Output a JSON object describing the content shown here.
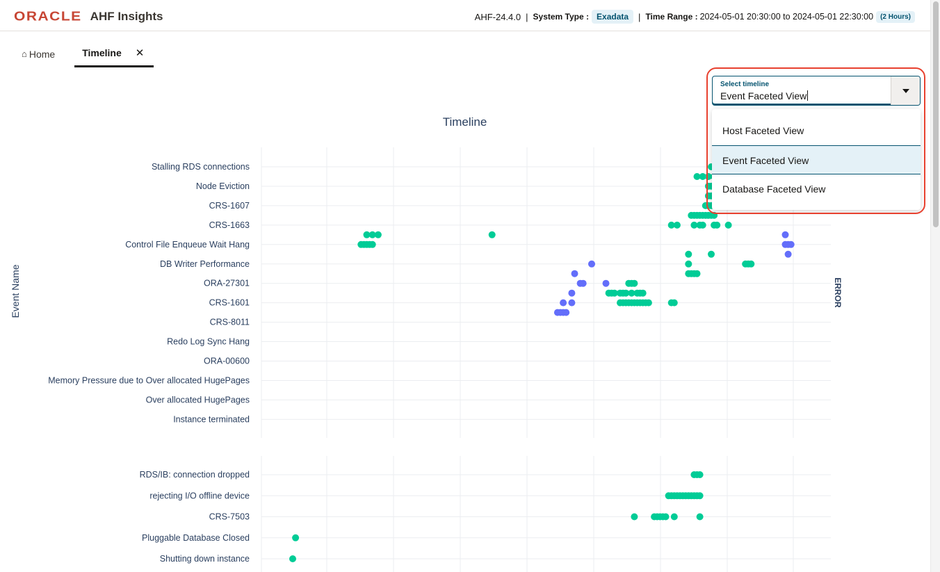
{
  "header": {
    "logo_text": "ORACLE",
    "app_name": "AHF Insights",
    "version": "AHF-24.4.0",
    "system_type_label": "System Type :",
    "system_type_value": "Exadata",
    "time_range_label": "Time Range :",
    "time_range_value": "2024-05-01 20:30:00 to 2024-05-01 22:30:00",
    "time_range_duration": "(2 Hours)"
  },
  "tabs": [
    {
      "label": "Home",
      "icon": "home-icon"
    },
    {
      "label": "Timeline",
      "close_icon": "close-icon"
    }
  ],
  "select": {
    "caption": "Select timeline",
    "value": "Event Faceted View",
    "options": [
      "Host Faceted View",
      "Event Faceted View",
      "Database Faceted View"
    ],
    "selected_index": 1
  },
  "colors": {
    "accent": "#04536f",
    "oracle_red": "#c74634",
    "highlight_red": "#e8412f",
    "marker_green": "#00cc96",
    "marker_purple": "#636efa"
  },
  "chart_data": {
    "type": "scatter",
    "title": "Timeline",
    "ylabel": "Event Name",
    "facets": [
      {
        "name": "ERROR",
        "categories": [
          "Stalling RDS connections",
          "Node Eviction",
          "CRS-1607",
          "CRS-1663",
          "Control File Enqueue Wait Hang",
          "DB Writer Performance",
          "ORA-27301",
          "CRS-1601",
          "CRS-8011",
          "Redo Log Sync Hang",
          "ORA-00600",
          "Memory Pressure due to Over allocated HugePages",
          "Over allocated HugePages",
          "Instance terminated"
        ],
        "series": [
          {
            "color": "#00cc96",
            "points": [
              [
                0,
                0.79
              ],
              [
                0,
                0.8
              ],
              [
                0,
                0.81
              ],
              [
                0,
                0.83
              ],
              [
                1,
                0.765
              ],
              [
                1,
                0.775
              ],
              [
                1,
                0.785
              ],
              [
                1,
                0.795
              ],
              [
                1,
                0.805
              ],
              [
                2,
                0.785
              ],
              [
                2,
                0.79
              ],
              [
                2,
                0.795
              ],
              [
                3,
                0.785
              ],
              [
                3,
                0.79
              ],
              [
                3,
                0.795
              ],
              [
                4,
                0.78
              ],
              [
                4,
                0.785
              ],
              [
                4,
                0.79
              ],
              [
                4,
                0.795
              ],
              [
                5,
                0.755
              ],
              [
                5,
                0.76
              ],
              [
                5,
                0.765
              ],
              [
                5,
                0.77
              ],
              [
                5,
                0.775
              ],
              [
                5,
                0.78
              ],
              [
                5,
                0.785
              ],
              [
                5,
                0.79
              ],
              [
                5,
                0.795
              ],
              [
                6,
                0.72
              ],
              [
                6,
                0.73
              ],
              [
                6,
                0.76
              ],
              [
                6,
                0.77
              ],
              [
                6,
                0.775
              ],
              [
                6,
                0.795
              ],
              [
                6,
                0.8
              ],
              [
                6,
                0.82
              ],
              [
                7,
                0.185
              ],
              [
                7,
                0.195
              ],
              [
                7,
                0.205
              ],
              [
                7,
                0.405
              ],
              [
                8,
                0.175
              ],
              [
                8,
                0.18
              ],
              [
                8,
                0.185
              ],
              [
                8,
                0.19
              ],
              [
                8,
                0.195
              ],
              [
                9,
                0.75
              ],
              [
                9,
                0.79
              ],
              [
                10,
                0.75
              ],
              [
                10,
                0.85
              ],
              [
                10,
                0.855
              ],
              [
                10,
                0.86
              ],
              [
                11,
                0.75
              ],
              [
                11,
                0.755
              ],
              [
                11,
                0.76
              ],
              [
                11,
                0.765
              ],
              [
                12,
                0.645
              ],
              [
                12,
                0.65
              ],
              [
                12,
                0.655
              ],
              [
                13,
                0.61
              ],
              [
                13,
                0.615
              ],
              [
                13,
                0.62
              ],
              [
                13,
                0.63
              ],
              [
                13,
                0.635
              ],
              [
                13,
                0.64
              ],
              [
                13,
                0.65
              ],
              [
                13,
                0.66
              ],
              [
                13,
                0.665
              ],
              [
                13,
                0.67
              ],
              [
                14,
                0.63
              ],
              [
                14,
                0.635
              ],
              [
                14,
                0.64
              ],
              [
                14,
                0.645
              ],
              [
                14,
                0.65
              ],
              [
                14,
                0.655
              ],
              [
                14,
                0.66
              ],
              [
                14,
                0.665
              ],
              [
                14,
                0.67
              ],
              [
                14,
                0.675
              ],
              [
                14,
                0.68
              ],
              [
                14,
                0.72
              ],
              [
                14,
                0.725
              ]
            ]
          },
          {
            "color": "#636efa",
            "points": [
              [
                7,
                0.92
              ],
              [
                8,
                0.92
              ],
              [
                8,
                0.925
              ],
              [
                8,
                0.93
              ],
              [
                9,
                0.925
              ],
              [
                10,
                0.58
              ],
              [
                11,
                0.55
              ],
              [
                12,
                0.56
              ],
              [
                12,
                0.565
              ],
              [
                12,
                0.605
              ],
              [
                13,
                0.545
              ],
              [
                14,
                0.53
              ],
              [
                14,
                0.545
              ],
              [
                15,
                0.52
              ],
              [
                15,
                0.525
              ],
              [
                15,
                0.53
              ],
              [
                15,
                0.535
              ]
            ]
          }
        ]
      },
      {
        "name": "",
        "categories": [
          "RDS/IB: connection dropped",
          "rejecting I/O offline device",
          "CRS-7503",
          "Pluggable Database  Closed",
          "Shutting down instance"
        ],
        "series": [
          {
            "color": "#00cc96",
            "points": [
              [
                0,
                0.76
              ],
              [
                0,
                0.765
              ],
              [
                0,
                0.77
              ],
              [
                1,
                0.715
              ],
              [
                1,
                0.72
              ],
              [
                1,
                0.725
              ],
              [
                1,
                0.73
              ],
              [
                1,
                0.735
              ],
              [
                1,
                0.74
              ],
              [
                1,
                0.745
              ],
              [
                1,
                0.75
              ],
              [
                1,
                0.755
              ],
              [
                1,
                0.76
              ],
              [
                1,
                0.765
              ],
              [
                1,
                0.77
              ],
              [
                2,
                0.655
              ],
              [
                2,
                0.69
              ],
              [
                2,
                0.695
              ],
              [
                2,
                0.7
              ],
              [
                2,
                0.705
              ],
              [
                2,
                0.71
              ],
              [
                2,
                0.725
              ],
              [
                2,
                0.77
              ],
              [
                3,
                0.06
              ],
              [
                4,
                0.055
              ]
            ]
          }
        ]
      }
    ]
  }
}
